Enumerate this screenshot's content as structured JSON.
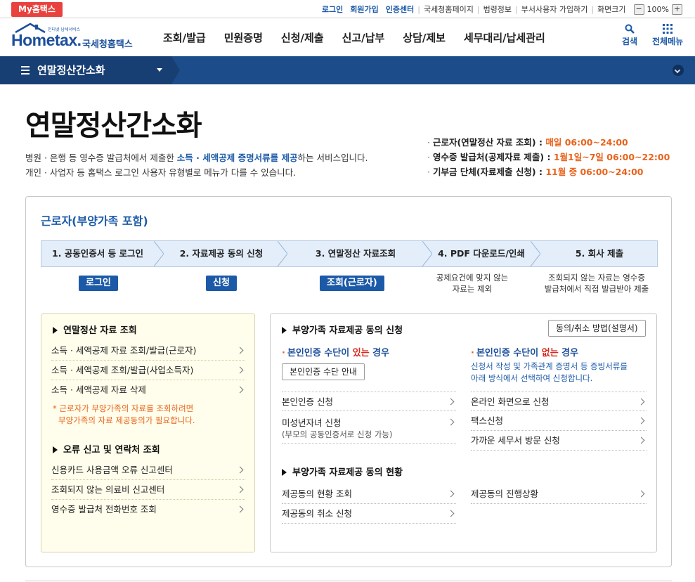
{
  "util": {
    "myhome": "My홈택스",
    "links": [
      "로그인",
      "회원가입",
      "인증센터",
      "국세청홈페이지",
      "법령정보",
      "부서사용자 가입하기",
      "화면크기"
    ],
    "zoom_minus": "−",
    "zoom_value": "100%",
    "zoom_plus": "+"
  },
  "header": {
    "logo_tag": "인터넷 납세서비스",
    "logo_text": "Hometax.",
    "logo_kr": "국세청홈택스",
    "nav": [
      "조회/발급",
      "민원증명",
      "신청/제출",
      "신고/납부",
      "상담/제보",
      "세무대리/납세관리"
    ],
    "search_label": "검색",
    "menu_label": "전체메뉴"
  },
  "breadcrumb": {
    "title": "연말정산간소화"
  },
  "intro": {
    "title": "연말정산간소화",
    "desc1_pre": "병원 · 은행 등 영수증 발급처에서 제출한 ",
    "desc1_em": "소득 · 세액공제 증명서류를 제공",
    "desc1_post": "하는 서비스입니다.",
    "desc2": "개인 · 사업자 등 홈택스 로그인 사용자 유형별로 메뉴가 다를 수 있습니다.",
    "schedule": [
      {
        "label": "근로자(연말정산 자료 조회) : ",
        "day": "매일 ",
        "time": "06:00~24:00"
      },
      {
        "label": "영수증 발급처(공제자료 제출) : ",
        "day": "1월1일~7일 ",
        "time": "06:00~22:00"
      },
      {
        "label": "기부금 단체(자료제출 신청) : ",
        "day": "11월 중 ",
        "time": "06:00~24:00"
      }
    ]
  },
  "main": {
    "title": "근로자(부양가족 포함)",
    "steps": [
      "1. 공동인증서 등 로그인",
      "2. 자료제공 동의 신청",
      "3. 연말정산 자료조회",
      "4. PDF 다운로드/인쇄",
      "5. 회사 제출"
    ],
    "step_buttons": [
      "로그인",
      "신청",
      "조회(근로자)"
    ],
    "step4_note": [
      "공제요건에 맞지 않는",
      "자료는 제외"
    ],
    "step5_note": [
      "조회되지 않는 자료는 영수증",
      "발급처에서 직접 발급받아 제출"
    ]
  },
  "left": {
    "sec1_title": "연말정산 자료 조회",
    "sec1_items": [
      "소득 · 세액공제 자료 조회/발급(근로자)",
      "소득 · 세액공제 조회/발급(사업소득자)",
      "소득 · 세액공제 자료 삭제"
    ],
    "note1": "* 근로자가 부양가족의 자료를 조회하려면",
    "note2": "부양가족의 자료 제공동의가 필요합니다.",
    "sec2_title": "오류 신고 및 연락처 조회",
    "sec2_items": [
      "신용카드 사용금액 오류 신고센터",
      "조회되지 않는 의료비 신고센터",
      "영수증 발급처 전화번호 조회"
    ]
  },
  "right": {
    "sec1_title": "부양가족 자료제공 동의 신청",
    "method_button": "동의/취소 방법(설명서)",
    "has_pre": "본인인증 수단이 ",
    "has_red": "있는",
    "has_post": " 경우",
    "guide_button": "본인인증 수단 안내",
    "no_pre": "본인인증 수단이 ",
    "no_red": "없는",
    "no_post": " 경우",
    "no_desc1": "신청서 작성 및 가족관계 증명서 등 증빙서류를",
    "no_desc2": "아래 방식에서 선택하여 신청합니다.",
    "left_items": [
      {
        "label": "본인인증 신청",
        "sub": ""
      },
      {
        "label": "미성년자녀 신청",
        "sub": "(부모의 공동인증서로 신청 가능)"
      }
    ],
    "right_items": [
      "온라인 화면으로 신청",
      "팩스신청",
      "가까운 세무서 방문 신청"
    ],
    "sec2_title": "부양가족 자료제공 동의 현황",
    "status_items": [
      "제공동의 현황 조회",
      "제공동의 취소 신청"
    ],
    "status_right": "제공동의 진행상황"
  },
  "colors": {
    "brand_blue": "#1c5aa8",
    "nav_bar": "#1d4c8a",
    "accent_orange": "#e8631c",
    "red": "#d9281e"
  }
}
